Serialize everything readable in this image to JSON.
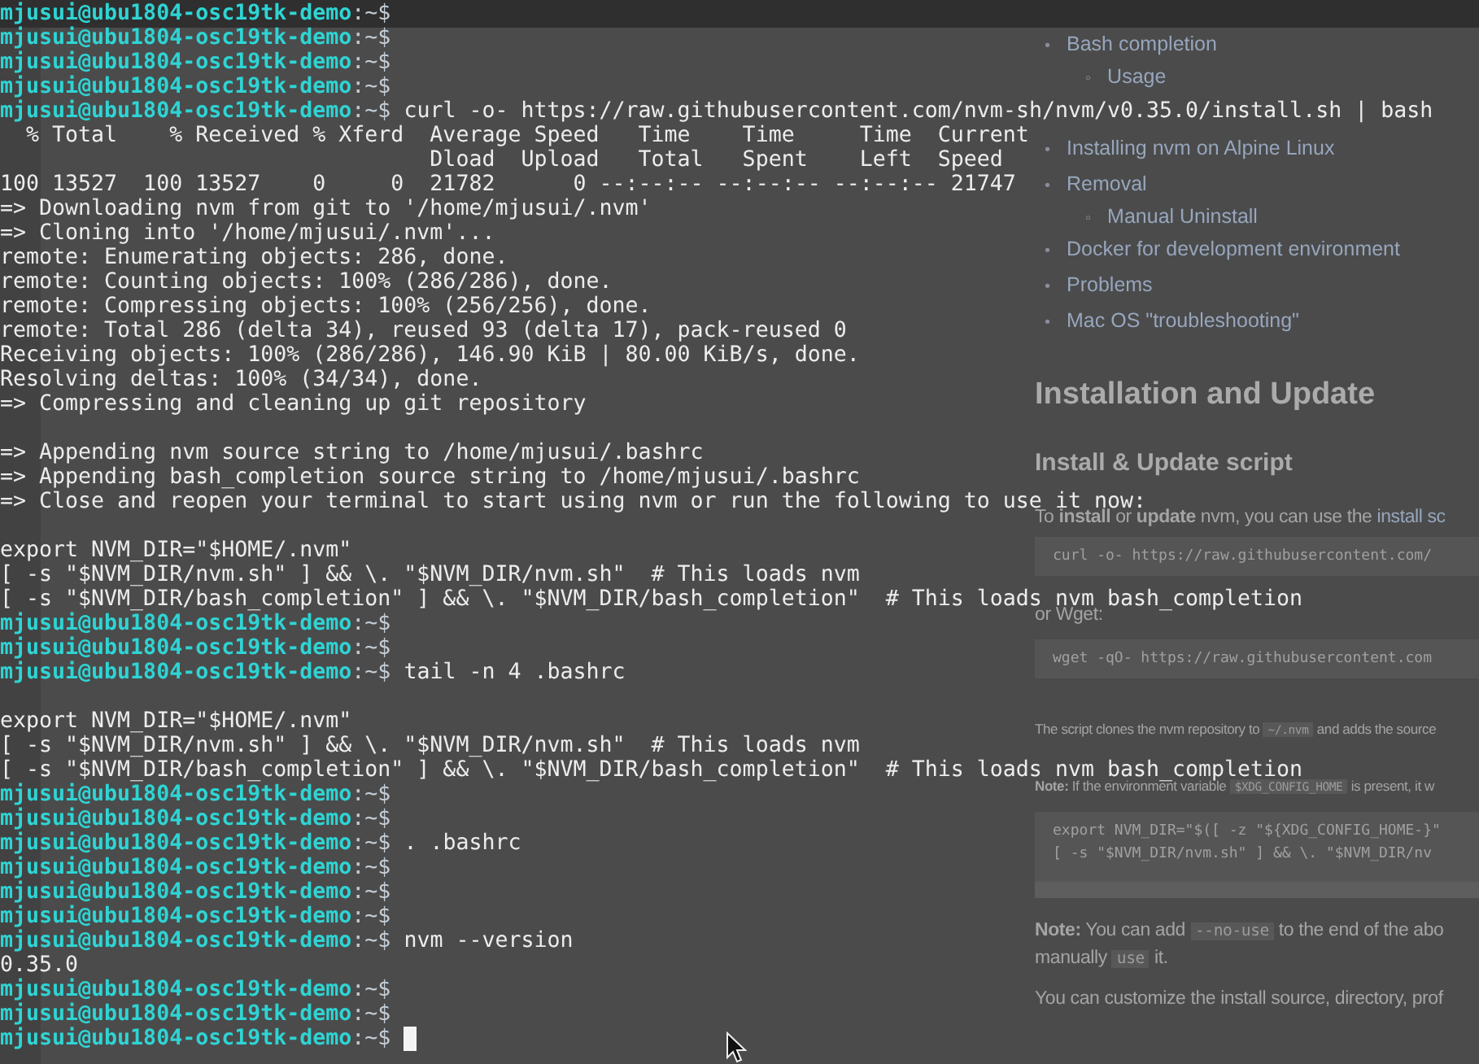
{
  "web_page": {
    "toc": [
      {
        "marker": "•",
        "text": "Bash completion",
        "children": [
          {
            "marker": "◦",
            "text": "Usage"
          }
        ]
      },
      {
        "marker": "•",
        "text": "Installing nvm on Alpine Linux"
      },
      {
        "marker": "•",
        "text": "Removal",
        "children": [
          {
            "marker": "◦",
            "text": "Manual Uninstall"
          }
        ]
      },
      {
        "marker": "•",
        "text": "Docker for development environment"
      },
      {
        "marker": "•",
        "text": "Problems"
      },
      {
        "marker": "•",
        "text": "Mac OS \"troubleshooting\""
      }
    ],
    "heading": "Installation and Update",
    "subheading": "Install & Update script",
    "blocks": [
      {
        "kind": "para",
        "lines": [
          [
            {
              "kind": "text",
              "text": "To **install** or **update** nvm, you can use the "
            },
            {
              "kind": "link",
              "text": "install sc"
            }
          ]
        ]
      },
      {
        "kind": "code",
        "lines": [
          "curl -o- https://raw.githubusercontent.com/"
        ]
      },
      {
        "kind": "para",
        "lines": [
          [
            {
              "kind": "text",
              "text": "or Wget:"
            }
          ]
        ]
      },
      {
        "kind": "code",
        "lines": [
          "wget -qO- https://raw.githubusercontent.com"
        ]
      },
      {
        "kind": "small_para",
        "lines": [
          [
            {
              "kind": "text",
              "text": "The script clones the nvm repository to "
            },
            {
              "kind": "code",
              "text": "~/.nvm"
            },
            {
              "kind": "text",
              "text": " and adds the source"
            }
          ]
        ]
      },
      {
        "kind": "small_para",
        "lines": [
          [
            {
              "kind": "text",
              "text": "**Note:** If the environment variable "
            },
            {
              "kind": "code",
              "text": "$XDG_CONFIG_HOME"
            },
            {
              "kind": "text",
              "text": " is present, it w"
            }
          ]
        ]
      },
      {
        "kind": "code",
        "scrollbar": true,
        "lines": [
          "export NVM_DIR=\"$([ -z \"${XDG_CONFIG_HOME-}\"",
          "[ -s \"$NVM_DIR/nvm.sh\" ] && \\. \"$NVM_DIR/nv"
        ]
      },
      {
        "kind": "para",
        "lines": [
          [
            {
              "kind": "text",
              "text": "**Note:** You can add "
            },
            {
              "kind": "code",
              "text": "--no-use"
            },
            {
              "kind": "text",
              "text": " to the end of the abo"
            }
          ],
          [
            {
              "kind": "text",
              "text": "manually "
            },
            {
              "kind": "code",
              "text": "use"
            },
            {
              "kind": "text",
              "text": " it."
            }
          ]
        ]
      },
      {
        "kind": "para",
        "lines": [
          [
            {
              "kind": "text",
              "text": "You can customize the install source, directory, prof"
            }
          ]
        ]
      }
    ]
  },
  "terminal": {
    "cursor_visible": true,
    "lines": [
      {
        "kind": "prompt",
        "host": "mjusui@ubu1804-osc19tk-demo",
        "path": ":~$"
      },
      {
        "kind": "prompt",
        "host": "mjusui@ubu1804-osc19tk-demo",
        "path": ":~$"
      },
      {
        "kind": "prompt",
        "host": "mjusui@ubu1804-osc19tk-demo",
        "path": ":~$"
      },
      {
        "kind": "prompt",
        "host": "mjusui@ubu1804-osc19tk-demo",
        "path": ":~$"
      },
      {
        "kind": "prompt",
        "host": "mjusui@ubu1804-osc19tk-demo",
        "path": ":~$",
        "command": "curl -o- https://raw.githubusercontent.com/nvm-sh/nvm/v0.35.0/install.sh | bash"
      },
      {
        "kind": "output",
        "text": "  % Total    % Received % Xferd  Average Speed   Time    Time     Time  Current"
      },
      {
        "kind": "output",
        "text": "                                 Dload  Upload   Total   Spent    Left  Speed"
      },
      {
        "kind": "output",
        "text": "100 13527  100 13527    0     0  21782      0 --:--:-- --:--:-- --:--:-- 21747"
      },
      {
        "kind": "output",
        "text": "=> Downloading nvm from git to '/home/mjusui/.nvm'"
      },
      {
        "kind": "output",
        "text": "=> Cloning into '/home/mjusui/.nvm'..."
      },
      {
        "kind": "output",
        "text": "remote: Enumerating objects: 286, done."
      },
      {
        "kind": "output",
        "text": "remote: Counting objects: 100% (286/286), done."
      },
      {
        "kind": "output",
        "text": "remote: Compressing objects: 100% (256/256), done."
      },
      {
        "kind": "output",
        "text": "remote: Total 286 (delta 34), reused 93 (delta 17), pack-reused 0"
      },
      {
        "kind": "output",
        "text": "Receiving objects: 100% (286/286), 146.90 KiB | 80.00 KiB/s, done."
      },
      {
        "kind": "output",
        "text": "Resolving deltas: 100% (34/34), done."
      },
      {
        "kind": "output",
        "text": "=> Compressing and cleaning up git repository"
      },
      {
        "kind": "blank"
      },
      {
        "kind": "output",
        "text": "=> Appending nvm source string to /home/mjusui/.bashrc"
      },
      {
        "kind": "output",
        "text": "=> Appending bash_completion source string to /home/mjusui/.bashrc"
      },
      {
        "kind": "output",
        "text": "=> Close and reopen your terminal to start using nvm or run the following to use it now:"
      },
      {
        "kind": "blank"
      },
      {
        "kind": "output",
        "text": "export NVM_DIR=\"$HOME/.nvm\""
      },
      {
        "kind": "output",
        "text": "[ -s \"$NVM_DIR/nvm.sh\" ] && \\. \"$NVM_DIR/nvm.sh\"  # This loads nvm"
      },
      {
        "kind": "output",
        "text": "[ -s \"$NVM_DIR/bash_completion\" ] && \\. \"$NVM_DIR/bash_completion\"  # This loads nvm bash_completion"
      },
      {
        "kind": "prompt",
        "host": "mjusui@ubu1804-osc19tk-demo",
        "path": ":~$"
      },
      {
        "kind": "prompt",
        "host": "mjusui@ubu1804-osc19tk-demo",
        "path": ":~$"
      },
      {
        "kind": "prompt",
        "host": "mjusui@ubu1804-osc19tk-demo",
        "path": ":~$",
        "command": "tail -n 4 .bashrc"
      },
      {
        "kind": "blank"
      },
      {
        "kind": "output",
        "text": "export NVM_DIR=\"$HOME/.nvm\""
      },
      {
        "kind": "output",
        "text": "[ -s \"$NVM_DIR/nvm.sh\" ] && \\. \"$NVM_DIR/nvm.sh\"  # This loads nvm"
      },
      {
        "kind": "output",
        "text": "[ -s \"$NVM_DIR/bash_completion\" ] && \\. \"$NVM_DIR/bash_completion\"  # This loads nvm bash_completion"
      },
      {
        "kind": "prompt",
        "host": "mjusui@ubu1804-osc19tk-demo",
        "path": ":~$"
      },
      {
        "kind": "prompt",
        "host": "mjusui@ubu1804-osc19tk-demo",
        "path": ":~$"
      },
      {
        "kind": "prompt",
        "host": "mjusui@ubu1804-osc19tk-demo",
        "path": ":~$",
        "command": ". .bashrc"
      },
      {
        "kind": "prompt",
        "host": "mjusui@ubu1804-osc19tk-demo",
        "path": ":~$"
      },
      {
        "kind": "prompt",
        "host": "mjusui@ubu1804-osc19tk-demo",
        "path": ":~$"
      },
      {
        "kind": "prompt",
        "host": "mjusui@ubu1804-osc19tk-demo",
        "path": ":~$"
      },
      {
        "kind": "prompt",
        "host": "mjusui@ubu1804-osc19tk-demo",
        "path": ":~$",
        "command": "nvm --version"
      },
      {
        "kind": "output",
        "text": "0.35.0"
      },
      {
        "kind": "prompt",
        "host": "mjusui@ubu1804-osc19tk-demo",
        "path": ":~$"
      },
      {
        "kind": "prompt",
        "host": "mjusui@ubu1804-osc19tk-demo",
        "path": ":~$"
      },
      {
        "kind": "prompt",
        "host": "mjusui@ubu1804-osc19tk-demo",
        "path": ":~$"
      }
    ]
  }
}
